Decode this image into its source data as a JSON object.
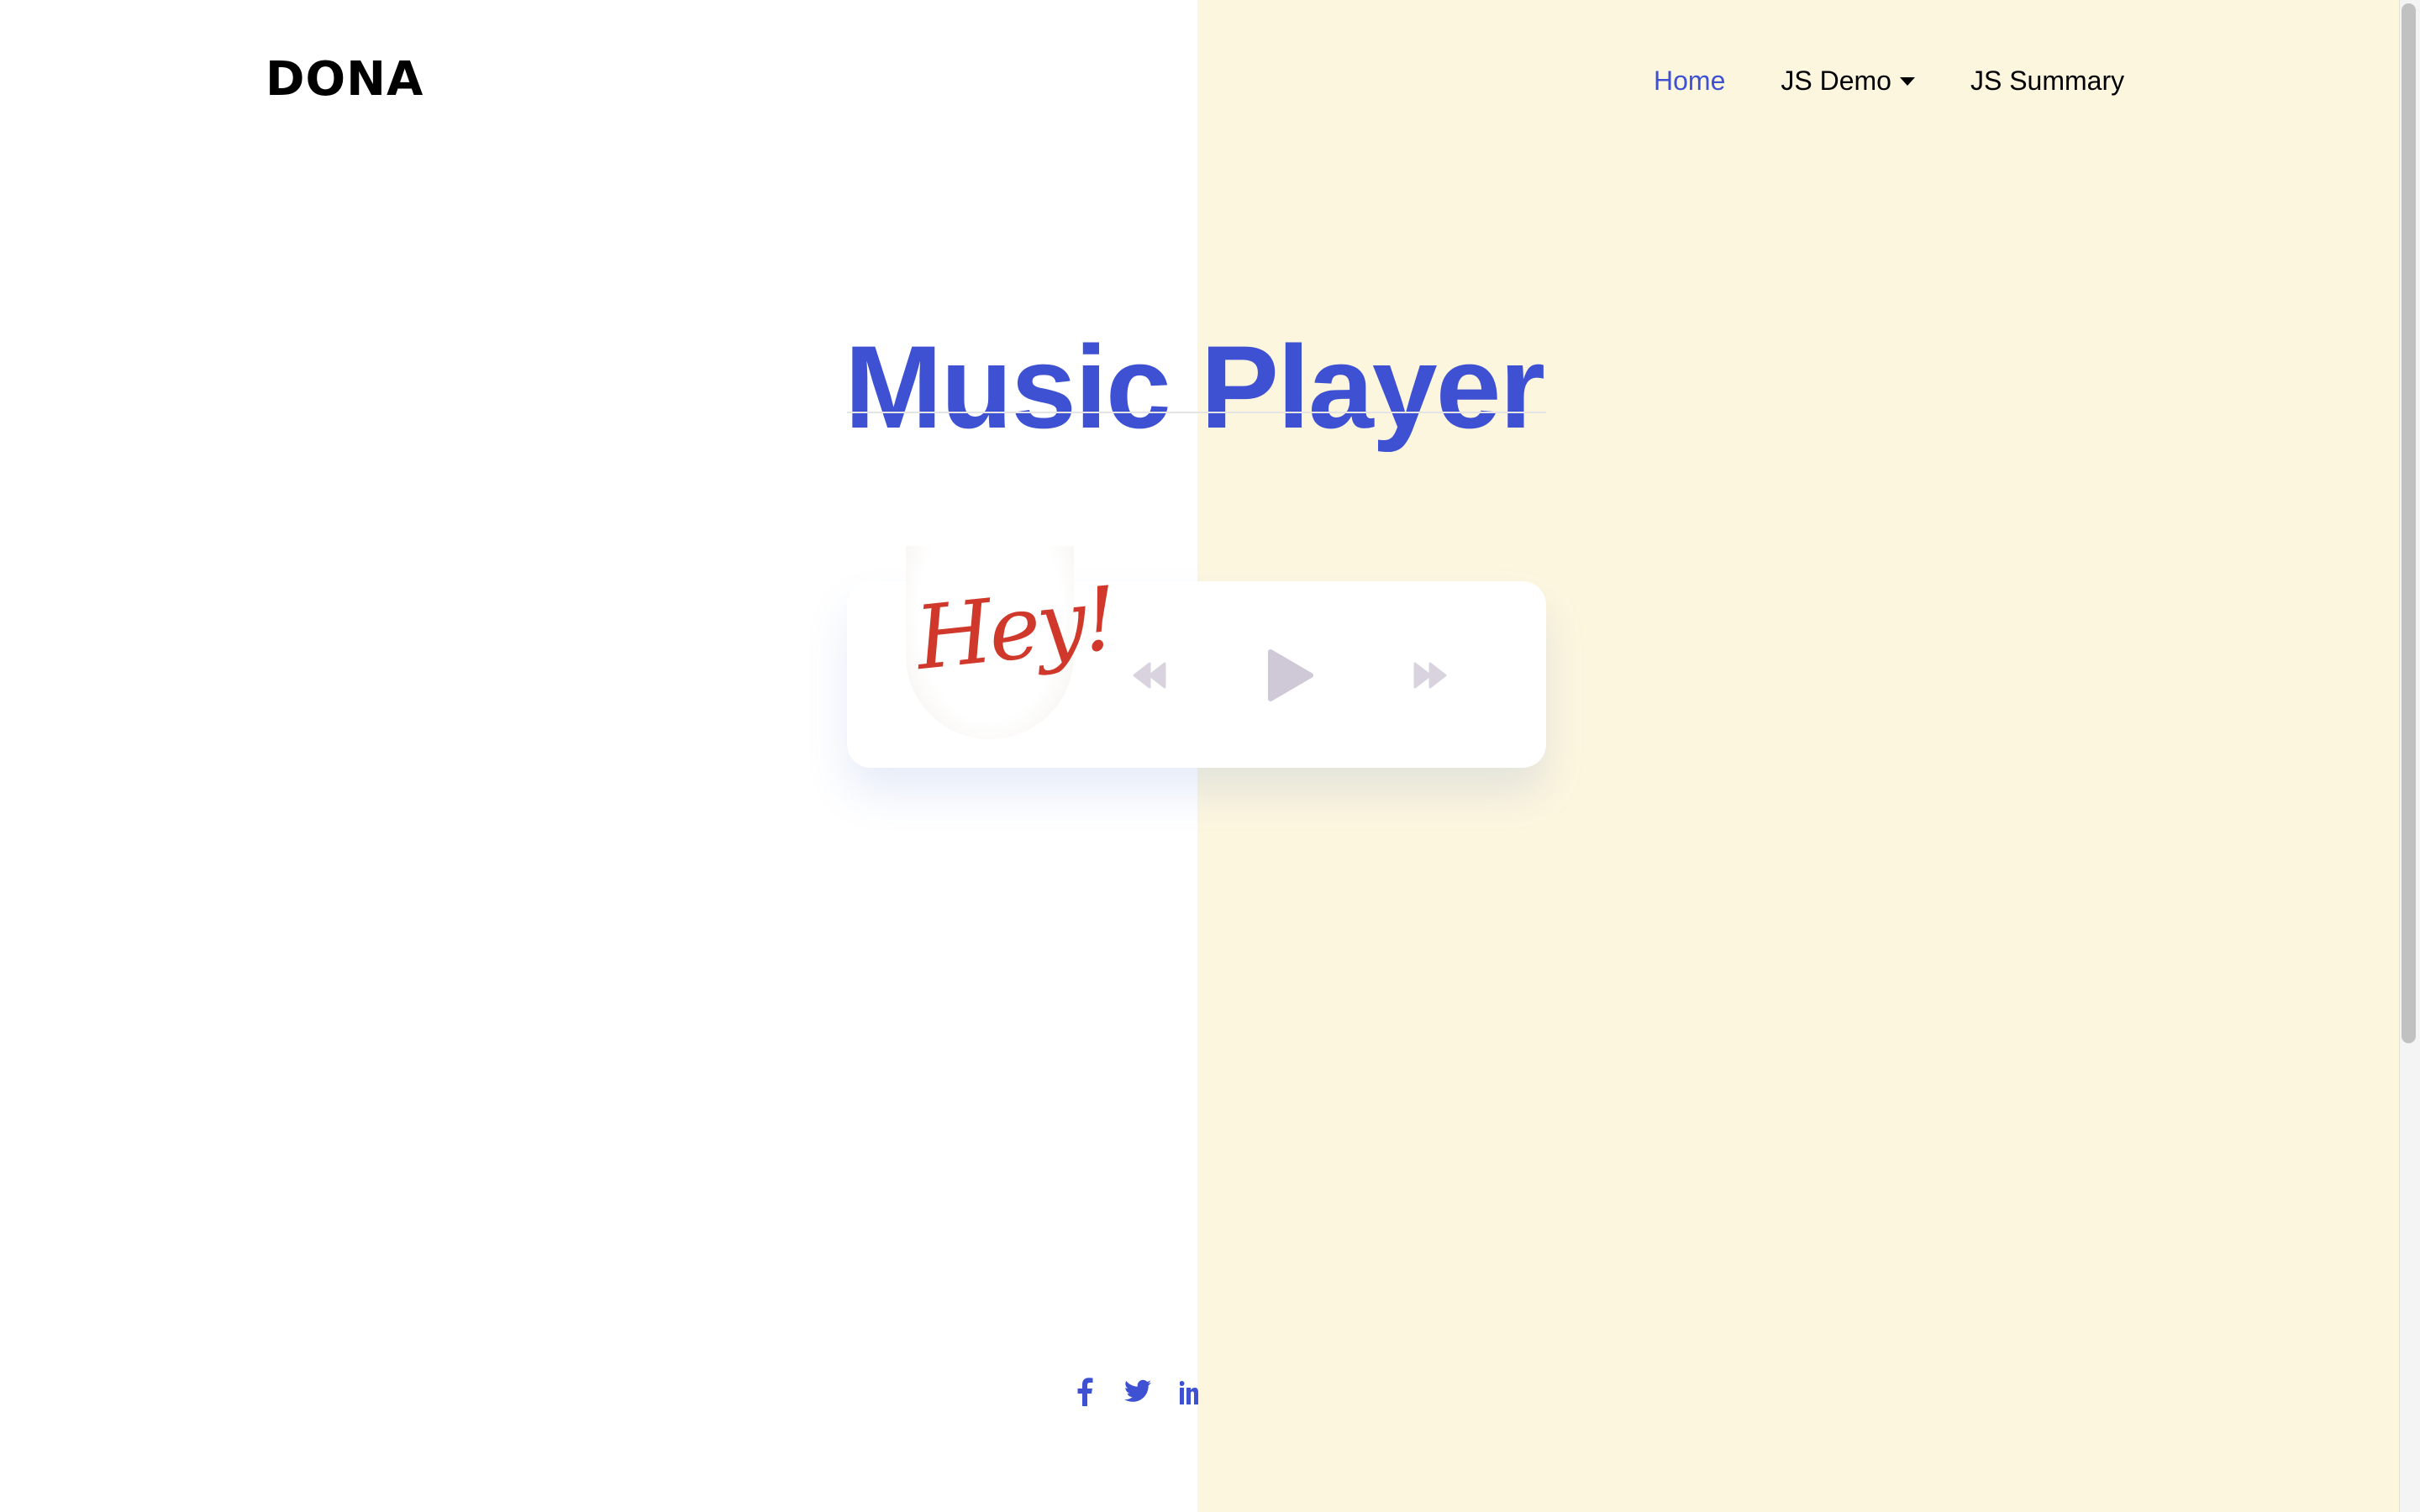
{
  "brand": {
    "logo_text": "DONA"
  },
  "nav": {
    "items": [
      {
        "label": "Home",
        "active": true
      },
      {
        "label": "JS Demo",
        "has_dropdown": true
      },
      {
        "label": "JS Summary"
      }
    ]
  },
  "main": {
    "title": "Music Player"
  },
  "player": {
    "album_art_text": "Hey!",
    "controls": [
      "rewind-icon",
      "play-icon",
      "fast-forward-icon"
    ]
  },
  "social": {
    "icons": [
      "facebook-icon",
      "twitter-icon",
      "linkedin-icon"
    ]
  },
  "colors": {
    "accent": "#3f51d3",
    "right_panel_bg": "#fdf6df",
    "control_gray": "#cfc8d6",
    "album_text_red": "#d0382b"
  }
}
